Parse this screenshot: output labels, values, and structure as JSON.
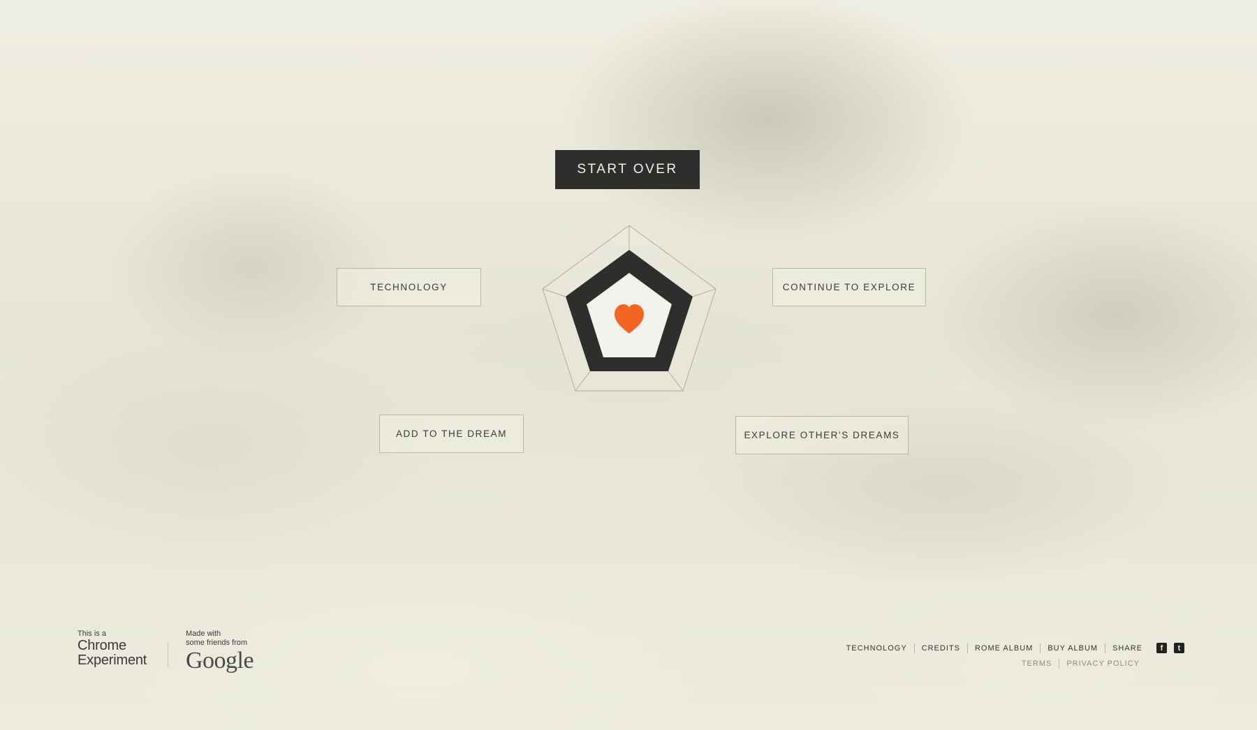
{
  "main": {
    "start_over_label": "START OVER",
    "technology_label": "TECHNOLOGY",
    "continue_label": "CONTINUE TO EXPLORE",
    "add_dream_label": "ADD TO THE DREAM",
    "explore_dreams_label": "EXPLORE OTHER'S DREAMS"
  },
  "emblem": {
    "icon": "heart-icon",
    "heart_color": "#f26522",
    "frame_color": "#2e2e2c",
    "inner_color": "#f3f2ec"
  },
  "footer": {
    "chrome": {
      "line1": "This is a",
      "line2": "Chrome",
      "line3": "Experiment"
    },
    "google": {
      "line1": "Made with",
      "line2": "some friends from",
      "wordmark": "Google"
    },
    "nav": [
      "TECHNOLOGY",
      "CREDITS",
      "ROME ALBUM",
      "BUY ALBUM",
      "SHARE"
    ],
    "social": [
      "facebook-icon",
      "twitter-icon"
    ],
    "legal": [
      "TERMS",
      "PRIVACY POLICY"
    ]
  }
}
